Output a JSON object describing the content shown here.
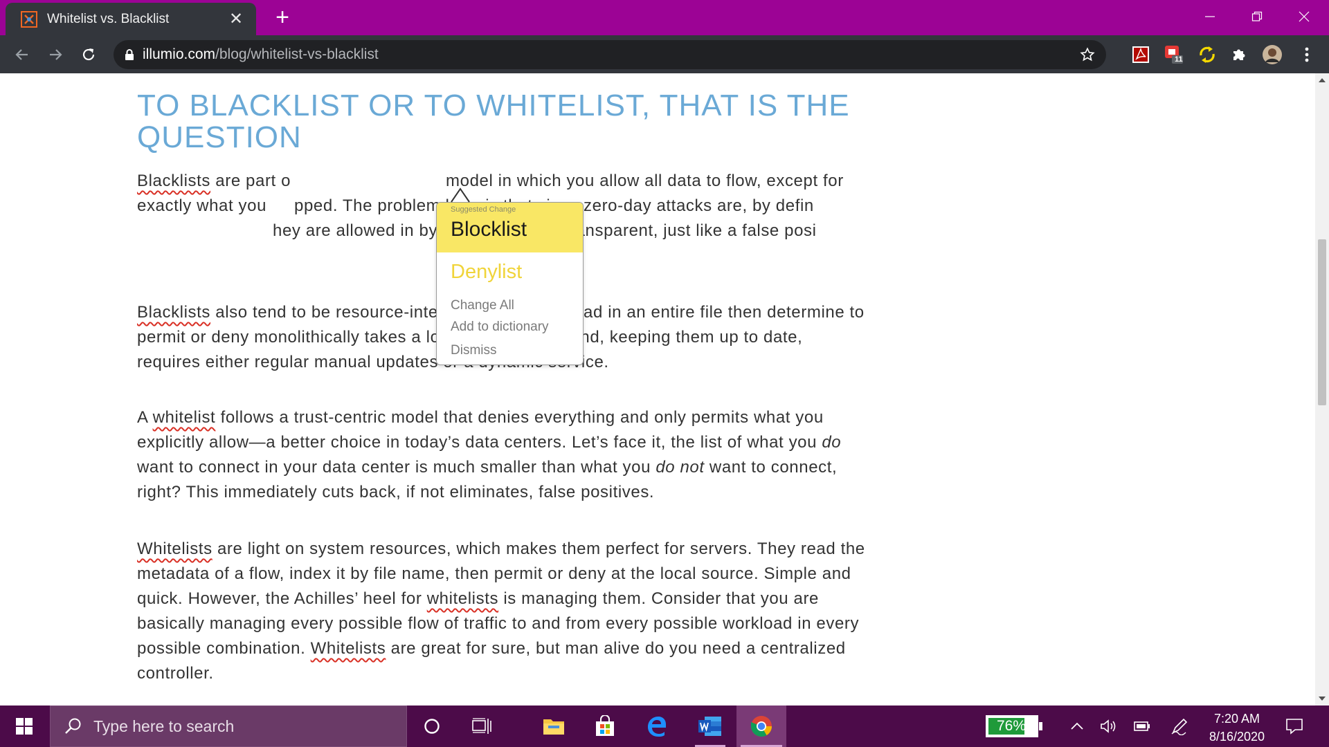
{
  "browser": {
    "tab_title": "Whitelist vs. Blacklist",
    "url_host": "illumio.com",
    "url_path": "/blog/whitelist-vs-blacklist",
    "extension_badge": "11"
  },
  "article": {
    "heading": "TO BLACKLIST OR TO WHITELIST, THAT IS THE QUESTION",
    "p1": {
      "w1": "Blacklists",
      "t1": " are part o",
      "t2": "model in which you allow all data to flow, except for exactly what you",
      "t3": "pped. The problem here is that since zero-day attacks are, by defin",
      "t4": "hey are allowed in by default and are transparent, just like a false posi"
    },
    "p2": {
      "w1": "Blacklists",
      "t1": " also tend to be resource-intensive. Having to read in an entire file then determine to permit or deny monolithically takes a lot of CPU cycles. And, keeping them up to date, requires either regular manual updates or a dynamic service."
    },
    "p3": {
      "t0": "A ",
      "w1": "whitelist",
      "t1": " follows a trust-centric model that denies everything and only permits what you explicitly allow—a better choice in today’s data centers. Let’s face it, the list of what you ",
      "em1": "do",
      "t2": " want to connect in your data center is much smaller than what you ",
      "em2": "do not",
      "t3": " want to connect, right? This immediately cuts back, if not eliminates, false positives."
    },
    "p4": {
      "w1": "Whitelists",
      "t1": " are light on system resources, which makes them perfect for servers. They read the metadata of a flow, index it by file name, then permit or deny at the local source. Simple and quick. However, the Achilles’ heel for ",
      "w2": "whitelists",
      "t2": " is managing them. Consider that you are basically managing every possible flow of traffic to and from every possible workload in every possible combination. ",
      "w3": "Whitelists",
      "t3": " are great for sure, but man alive do you need a centralized controller."
    }
  },
  "spell_popup": {
    "label": "Suggested Change",
    "suggestion": "Blocklist",
    "alternative": "Denylist",
    "change_all": "Change All",
    "add_dictionary": "Add to dictionary",
    "dismiss": "Dismiss"
  },
  "taskbar": {
    "search_placeholder": "Type here to search",
    "battery_percent": "76%",
    "battery_level": 0.76,
    "time": "7:20 AM",
    "date": "8/16/2020"
  },
  "colors": {
    "tab_strip": "#9c0395",
    "toolbar": "#33363c",
    "heading": "#6aa9d6",
    "suggestion_highlight": "#f9e765",
    "taskbar": "#4c0b49",
    "battery_fill": "#1f9a3a"
  }
}
